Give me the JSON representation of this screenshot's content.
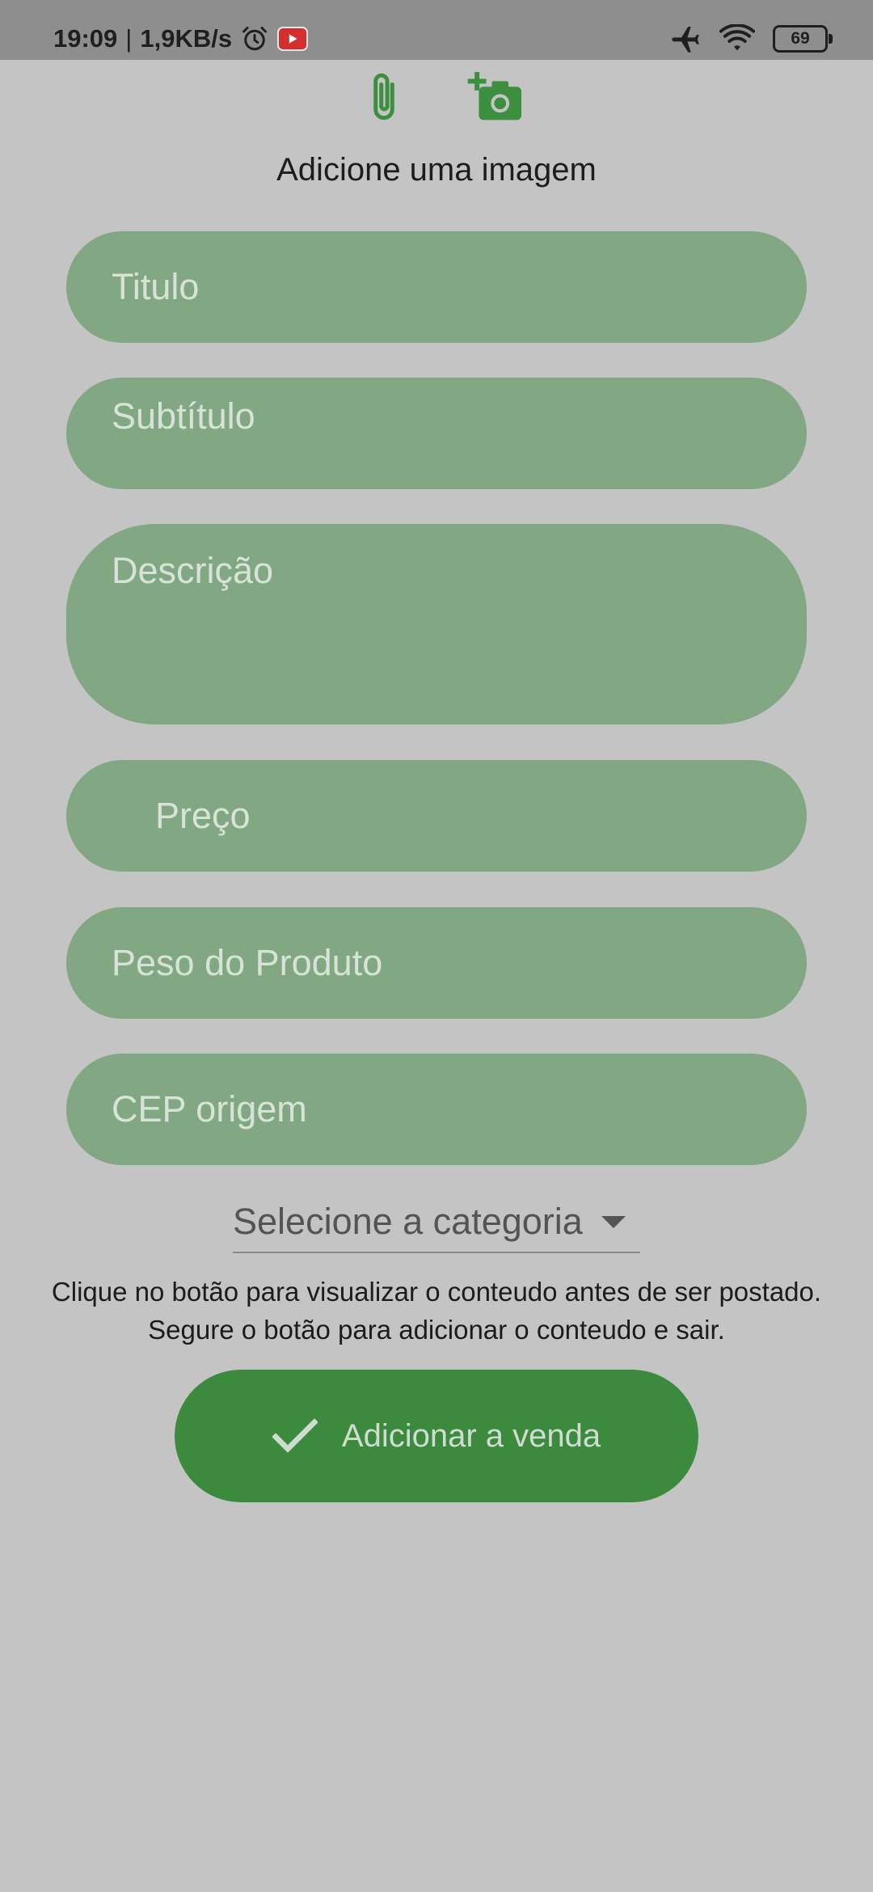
{
  "status_bar": {
    "time": "19:09",
    "separator": "|",
    "speed": "1,9KB/s",
    "battery": "69",
    "icons": [
      "alarm-icon",
      "youtube-icon",
      "airplane-icon",
      "wifi-icon",
      "battery-icon"
    ]
  },
  "attach": {
    "icons": [
      "paperclip-icon",
      "add-photo-icon"
    ],
    "label": "Adicione uma imagem"
  },
  "form": {
    "title_placeholder": "Titulo",
    "subtitle_placeholder": "Subtítulo",
    "description_placeholder": "Descrição",
    "price_placeholder": "Preço",
    "weight_placeholder": "Peso do Produto",
    "cep_placeholder": "CEP origem",
    "category_label": "Selecione a categoria",
    "hint_line1": "Clique no botão para visualizar o conteudo antes de ser postado.",
    "hint_line2": "Segure o botão para adicionar o conteudo e sair.",
    "submit_label": "Adicionar a venda"
  },
  "colors": {
    "background": "#c4c4c4",
    "status_bar": "#8e8e8e",
    "field": "#81a882",
    "field_text": "#d7e3d7",
    "accent": "#3b8a3e",
    "icon_green": "#3d8f40"
  }
}
